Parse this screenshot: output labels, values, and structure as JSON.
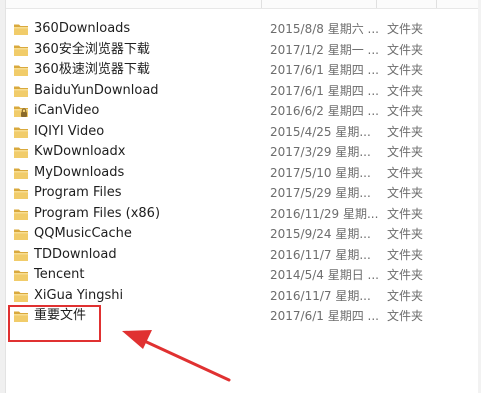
{
  "colors": {
    "annotation_red": "#e03131",
    "folder_yellow": "#e9c46a",
    "text_primary": "#1e1e1e",
    "text_secondary": "#6d6d6d"
  },
  "files": [
    {
      "name": "360Downloads",
      "date": "2015/8/8 星期六 ...",
      "type": "文件夹",
      "icon": "folder-icon"
    },
    {
      "name": "360安全浏览器下载",
      "date": "2017/1/2 星期一 ...",
      "type": "文件夹",
      "icon": "folder-icon"
    },
    {
      "name": "360极速浏览器下载",
      "date": "2017/6/1 星期四 ...",
      "type": "文件夹",
      "icon": "folder-icon"
    },
    {
      "name": "BaiduYunDownload",
      "date": "2017/6/1 星期四 ...",
      "type": "文件夹",
      "icon": "folder-icon"
    },
    {
      "name": "iCanVideo",
      "date": "2016/6/2 星期四 ...",
      "type": "文件夹",
      "icon": "locked-folder-icon"
    },
    {
      "name": "IQIYI Video",
      "date": "2015/4/25 星期...",
      "type": "文件夹",
      "icon": "folder-icon"
    },
    {
      "name": "KwDownloadx",
      "date": "2017/3/29 星期...",
      "type": "文件夹",
      "icon": "folder-icon"
    },
    {
      "name": "MyDownloads",
      "date": "2017/5/10 星期...",
      "type": "文件夹",
      "icon": "folder-icon"
    },
    {
      "name": "Program Files",
      "date": "2017/5/29 星期...",
      "type": "文件夹",
      "icon": "folder-icon"
    },
    {
      "name": "Program Files (x86)",
      "date": "2016/11/29 星期...",
      "type": "文件夹",
      "icon": "folder-icon"
    },
    {
      "name": "QQMusicCache",
      "date": "2015/9/24 星期...",
      "type": "文件夹",
      "icon": "folder-icon"
    },
    {
      "name": "TDDownload",
      "date": "2016/11/7 星期...",
      "type": "文件夹",
      "icon": "folder-icon"
    },
    {
      "name": "Tencent",
      "date": "2014/5/4 星期日 ...",
      "type": "文件夹",
      "icon": "folder-icon"
    },
    {
      "name": "XiGua Yingshi",
      "date": "2016/11/7 星期...",
      "type": "文件夹",
      "icon": "folder-icon"
    },
    {
      "name": "重要文件",
      "date": "2017/6/1 星期四 ...",
      "type": "文件夹",
      "icon": "folder-icon"
    }
  ]
}
